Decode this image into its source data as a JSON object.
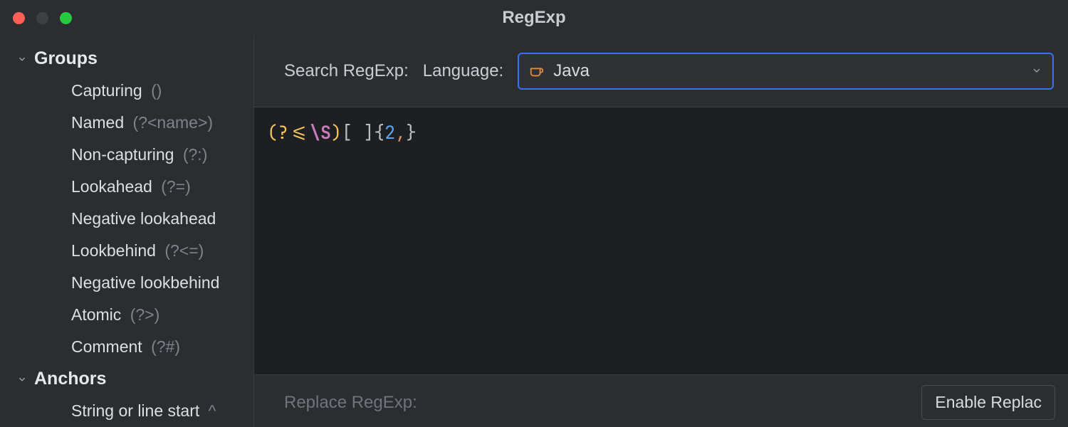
{
  "window": {
    "title": "RegExp"
  },
  "sidebar": {
    "sections": [
      {
        "label": "Groups",
        "expanded": true,
        "items": [
          {
            "label": "Capturing",
            "hint": "()"
          },
          {
            "label": "Named",
            "hint": "(?<name>)"
          },
          {
            "label": "Non-capturing",
            "hint": "(?:)"
          },
          {
            "label": "Lookahead",
            "hint": "(?=)"
          },
          {
            "label": "Negative lookahead",
            "hint": ""
          },
          {
            "label": "Lookbehind",
            "hint": "(?<=)"
          },
          {
            "label": "Negative lookbehind",
            "hint": ""
          },
          {
            "label": "Atomic",
            "hint": "(?>)"
          },
          {
            "label": "Comment",
            "hint": "(?#)"
          }
        ]
      },
      {
        "label": "Anchors",
        "expanded": true,
        "items": [
          {
            "label": "String or line start",
            "hint": "^"
          }
        ]
      }
    ]
  },
  "toolbar": {
    "search_label": "Search RegExp:",
    "language_label": "Language:",
    "language_value": "Java",
    "language_icon": "coffee-icon"
  },
  "editor": {
    "regex_raw": "(?<=\\S)[ ]{2,}",
    "tokens": [
      {
        "text": "(",
        "cls": "t-group"
      },
      {
        "text": "?<=",
        "cls": "t-group"
      },
      {
        "text": "\\S",
        "cls": "t-escape"
      },
      {
        "text": ")",
        "cls": "t-group"
      },
      {
        "text": "[ ]",
        "cls": "t-char"
      },
      {
        "text": "{",
        "cls": "t-paren"
      },
      {
        "text": "2",
        "cls": "t-number"
      },
      {
        "text": ",",
        "cls": "t-comma"
      },
      {
        "text": "}",
        "cls": "t-paren"
      }
    ]
  },
  "footer": {
    "replace_label": "Replace RegExp:",
    "enable_replace_label": "Enable Replac"
  }
}
